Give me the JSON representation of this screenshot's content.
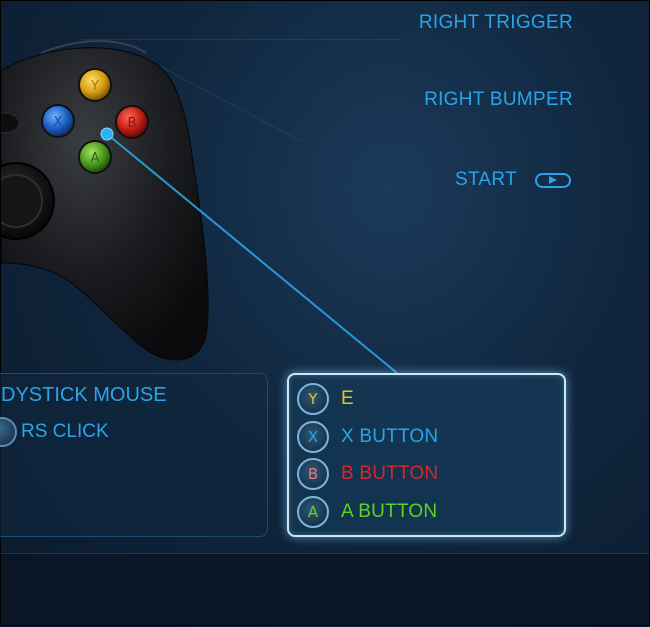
{
  "top_right": {
    "right_trigger": "RIGHT TRIGGER",
    "right_bumper": "RIGHT BUMPER",
    "start": "START"
  },
  "left_panel": {
    "title": "DYSTICK MOUSE",
    "rs_click": "RS CLICK"
  },
  "button_panel": {
    "rows": [
      {
        "glyph": "Y",
        "label": "E",
        "color": "#e8c21a"
      },
      {
        "glyph": "X",
        "label": "X BUTTON",
        "color": "#2aa4e8"
      },
      {
        "glyph": "B",
        "label": "B BUTTON",
        "color": "#d42828"
      },
      {
        "glyph": "A",
        "label": "A BUTTON",
        "color": "#5ed21e"
      }
    ]
  },
  "colors": {
    "accent": "#2aa4e8",
    "background": "#10263e"
  }
}
